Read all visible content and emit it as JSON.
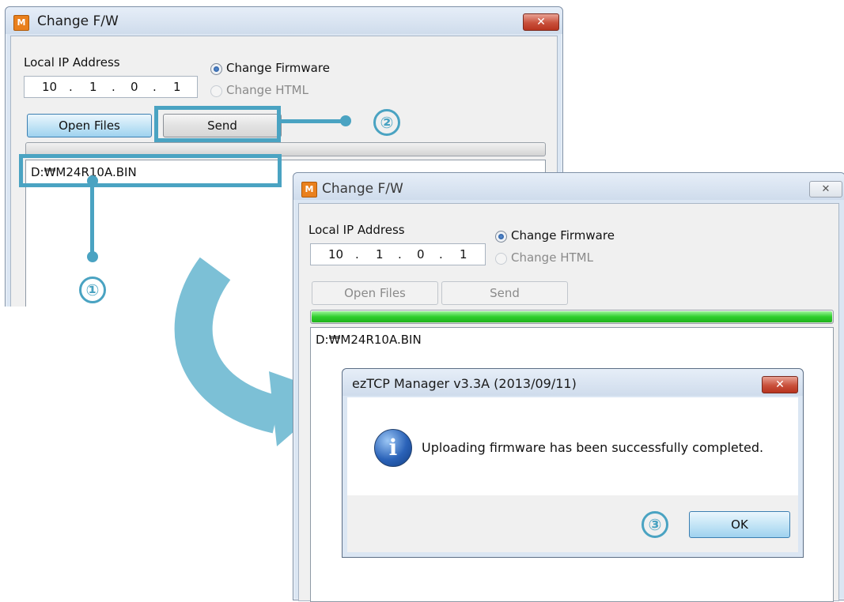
{
  "back_window": {
    "title": "Change F/W",
    "close_glyph": "✕",
    "ip_label": "Local IP Address",
    "ip": [
      "10",
      "1",
      "0",
      "1"
    ],
    "radio_firmware": "Change Firmware",
    "radio_html": "Change HTML",
    "open_files": "Open Files",
    "send": "Send",
    "file_path": "D:₩M24R10A.BIN"
  },
  "front_window": {
    "title": "Change F/W",
    "close_glyph": "✕",
    "ip_label": "Local IP Address",
    "ip": [
      "10",
      "1",
      "0",
      "1"
    ],
    "radio_firmware": "Change Firmware",
    "radio_html": "Change HTML",
    "open_files": "Open Files",
    "send": "Send",
    "progress_fraction": 1.0,
    "file_path": "D:₩M24R10A.BIN"
  },
  "message_box": {
    "title": "ezTCP Manager v3.3A (2013/09/11)",
    "close_glyph": "✕",
    "icon": "info-icon",
    "message": "Uploading firmware has been successfully completed.",
    "ok": "OK"
  },
  "callouts": {
    "step1": "①",
    "step2": "②",
    "step3": "③"
  },
  "colors": {
    "callout": "#4aa3c2",
    "progress": "#2fcf2c"
  }
}
